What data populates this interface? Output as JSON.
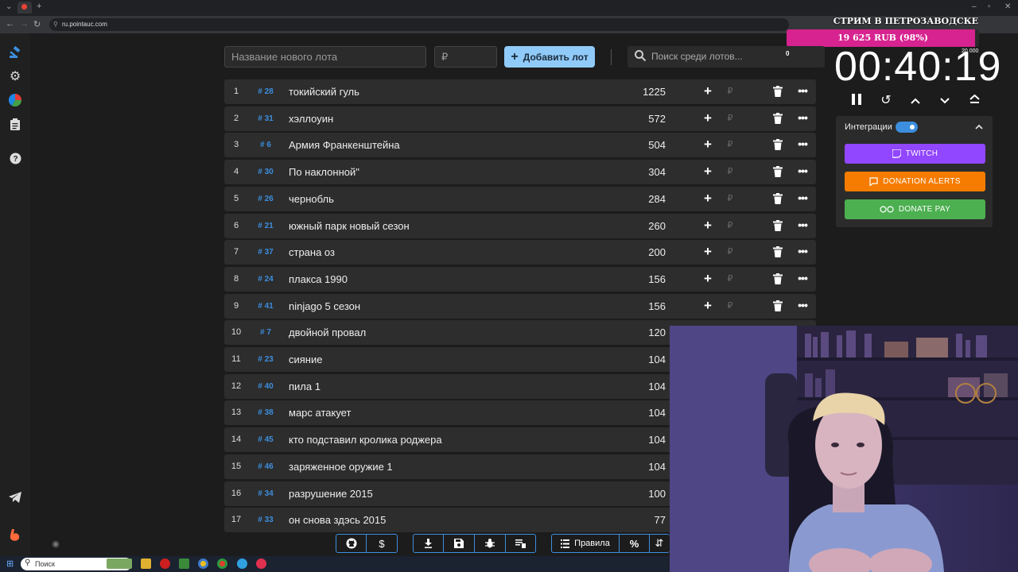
{
  "browser": {
    "url": "ru.pointauc.com"
  },
  "stream": {
    "title": "СТРИМ В ПЕТРОЗАВОДСКЕ",
    "goal_text": "19 625 RUB (98%)",
    "goal_progress": 0.98,
    "goal_target": "20 000",
    "goal_color": "#d6238f"
  },
  "toolbar": {
    "lot_name_placeholder": "Название нового лота",
    "price_placeholder": "₽",
    "add_button_label": "Добавить лот",
    "search_placeholder": "Поиск среди лотов...",
    "counter": "0"
  },
  "lots": [
    {
      "index": "1",
      "id": "# 28",
      "name": "токийский гуль",
      "amount": "1225"
    },
    {
      "index": "2",
      "id": "# 31",
      "name": "хэллоуин",
      "amount": "572"
    },
    {
      "index": "3",
      "id": "# 6",
      "name": "Армия Франкенштейна",
      "amount": "504"
    },
    {
      "index": "4",
      "id": "# 30",
      "name": "По наклонной\"",
      "amount": "304"
    },
    {
      "index": "5",
      "id": "# 26",
      "name": "чернобль",
      "amount": "284"
    },
    {
      "index": "6",
      "id": "# 21",
      "name": "южный парк новый сезон",
      "amount": "260"
    },
    {
      "index": "7",
      "id": "# 37",
      "name": "страна оз",
      "amount": "200"
    },
    {
      "index": "8",
      "id": "# 24",
      "name": "плакса 1990",
      "amount": "156"
    },
    {
      "index": "9",
      "id": "# 41",
      "name": "ninjago 5 сезон",
      "amount": "156"
    },
    {
      "index": "10",
      "id": "# 7",
      "name": " двойной провал",
      "amount": "120"
    },
    {
      "index": "11",
      "id": "# 23",
      "name": "сияние",
      "amount": "104"
    },
    {
      "index": "12",
      "id": "# 40",
      "name": "пила 1",
      "amount": "104"
    },
    {
      "index": "13",
      "id": "# 38",
      "name": "марс атакует",
      "amount": "104"
    },
    {
      "index": "14",
      "id": "# 45",
      "name": "кто подставил кролика роджера",
      "amount": "104"
    },
    {
      "index": "15",
      "id": "# 46",
      "name": "заряженное оружие 1",
      "amount": "104"
    },
    {
      "index": "16",
      "id": "# 34",
      "name": "разрушение 2015",
      "amount": "100"
    },
    {
      "index": "17",
      "id": "# 33",
      "name": "он снова здэсь 2015",
      "amount": "77"
    }
  ],
  "row_actions": {
    "rub_symbol": "₽"
  },
  "timer": {
    "value": "00:40:19"
  },
  "integrations": {
    "label": "Интеграции",
    "enabled": true,
    "twitch_label": "TWITCH",
    "twitch_color": "#9146ff",
    "donation_alerts_label": "DONATION ALERTS",
    "donation_alerts_color": "#f57c00",
    "donate_pay_label": "DONATE PAY",
    "donate_pay_color": "#4caf50"
  },
  "bottom_toolbar": {
    "rules_label": "Правила"
  },
  "taskbar": {
    "search_placeholder": "Поиск"
  }
}
